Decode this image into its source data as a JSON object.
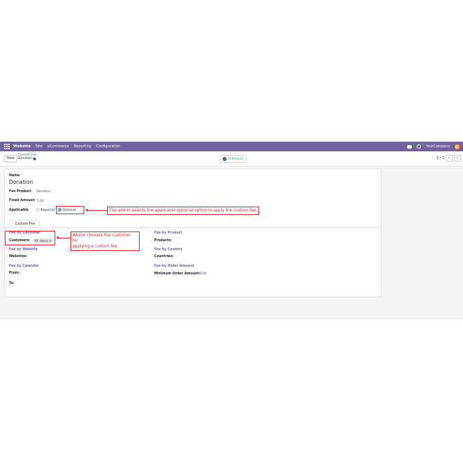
{
  "navbar": {
    "brand": "Website",
    "menu": [
      "Site",
      "eCommerce",
      "Reporting",
      "Configuration"
    ],
    "company": "YourCompany"
  },
  "control": {
    "new_label": "New",
    "breadcrumb_parent": "Custom Fee",
    "breadcrumb_current": "Donation",
    "published_label": "Published",
    "pager": "2 / 3"
  },
  "form": {
    "name_label": "Name",
    "name_value": "Donation",
    "fee_product_label": "Fee Product",
    "fee_product_value": "Donation",
    "fixed_amount_label": "Fixed Amount",
    "fixed_amount_value": "5.00",
    "applicable_label": "Applicable",
    "applicable_options": [
      "Required",
      "Optional"
    ],
    "applicable_selected": "Optional",
    "tab_label": "Custom Fee",
    "fee_by_customer": "Fee by Customer",
    "customers_label": "Customers:",
    "customer_tag": "SY, Harry",
    "fee_by_website": "Fee by Website",
    "websites_label": "Websites:",
    "fee_by_calendar": "Fee by Calendar",
    "from_label": "From:",
    "to_label": "To:",
    "fee_by_product": "Fee by Product",
    "products_label": "Products:",
    "fee_by_country": "Fee by Country",
    "countries_label": "Countries:",
    "fee_by_order_amount": "Fee by Order Amount",
    "min_order_label": "Minimum Order Amount:",
    "min_order_value": "0.00"
  },
  "annotations": {
    "optional_note": "The admin selects the applicable optional option to apply the custom fee.",
    "customer_note_line1": "Admin chooses the customer for",
    "customer_note_line2": "applying a custom fee."
  },
  "colors": {
    "navbar": "#71639e",
    "annotation": "#e02020",
    "published": "#28a745"
  }
}
